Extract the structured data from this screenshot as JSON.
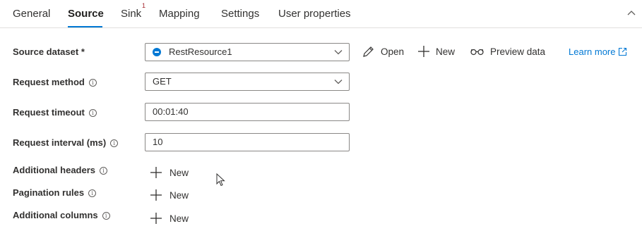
{
  "tabs": [
    {
      "label": "General"
    },
    {
      "label": "Source"
    },
    {
      "label": "Sink",
      "badge": "1"
    },
    {
      "label": "Mapping"
    },
    {
      "label": "Settings"
    },
    {
      "label": "User properties"
    }
  ],
  "active_tab": "Source",
  "source_dataset": {
    "label": "Source dataset *",
    "value": "RestResource1",
    "actions": {
      "open": "Open",
      "new": "New",
      "preview": "Preview data",
      "learn_more": "Learn more"
    }
  },
  "request_method": {
    "label": "Request method",
    "value": "GET"
  },
  "request_timeout": {
    "label": "Request timeout",
    "value": "00:01:40"
  },
  "request_interval": {
    "label": "Request interval (ms)",
    "value": "10"
  },
  "additional_headers": {
    "label": "Additional headers",
    "button": "New"
  },
  "pagination_rules": {
    "label": "Pagination rules",
    "button": "New"
  },
  "additional_columns": {
    "label": "Additional columns",
    "button": "New"
  },
  "colors": {
    "accent": "#0078d4",
    "text": "#323130",
    "border": "#8a8886",
    "badge": "#a4262c"
  },
  "icons": [
    "chevron-up-icon",
    "chevron-down-icon",
    "dataset-icon",
    "pencil-icon",
    "plus-icon",
    "glasses-icon",
    "external-link-icon",
    "info-icon",
    "mouse-pointer-icon"
  ]
}
